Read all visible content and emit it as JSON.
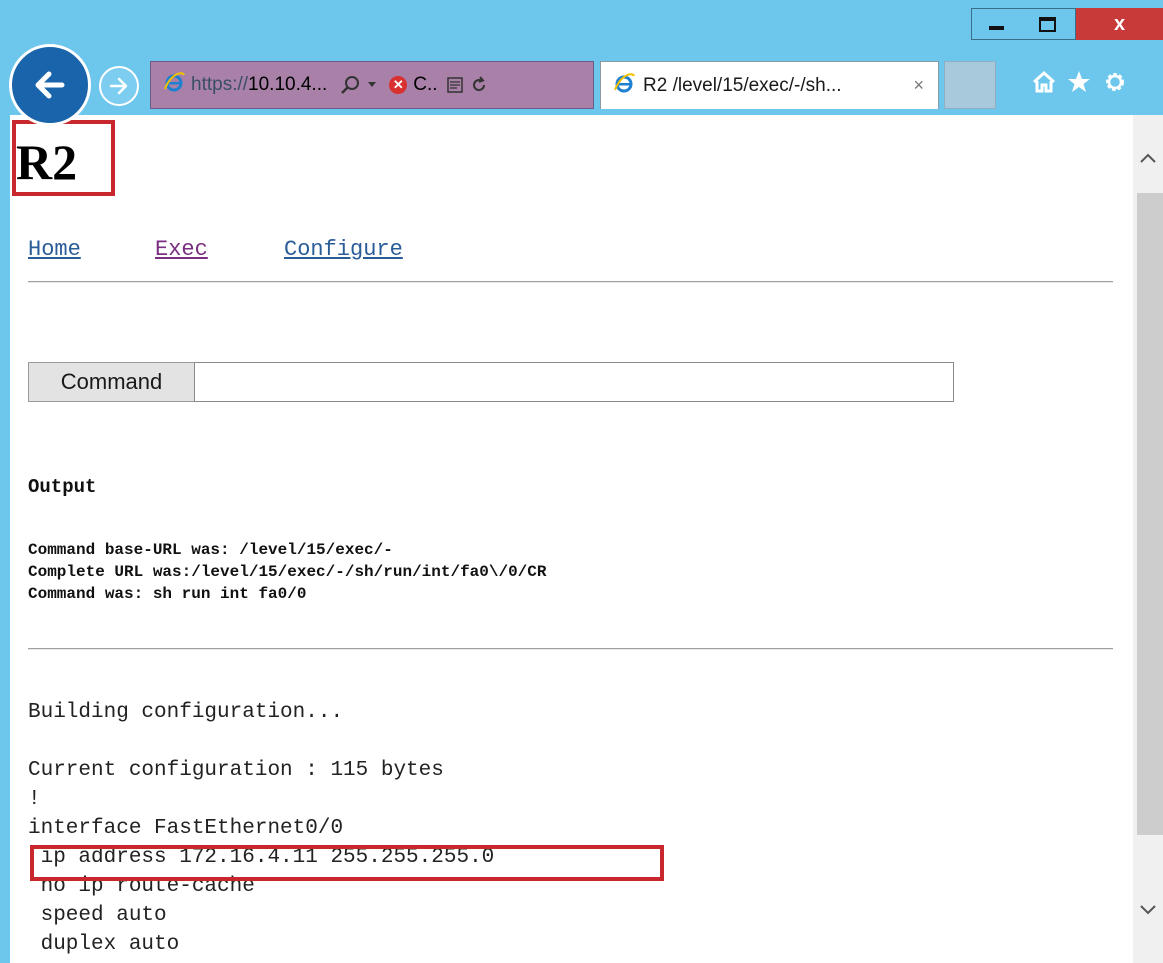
{
  "browser": {
    "address_protocol": "https://",
    "address_host": "10.10.4...",
    "cert_label": "C..",
    "tab_title": "R2 /level/15/exec/-/sh...",
    "tab_close": "×",
    "close_label": "x"
  },
  "page": {
    "title": "R2",
    "nav": {
      "home": "Home",
      "exec": "Exec",
      "configure": "Configure"
    },
    "command_button": "Command",
    "command_value": "",
    "output_heading": "Output",
    "command_info": [
      "Command base-URL was: /level/15/exec/-",
      "Complete URL was:/level/15/exec/-/sh/run/int/fa0\\/0/CR",
      "Command was: sh run int fa0/0"
    ],
    "config": {
      "building": "Building configuration...",
      "current": "Current configuration : 115 bytes",
      "bang": "!",
      "interface": "interface FastEthernet0/0",
      "ip_address": " ip address 172.16.4.11 255.255.255.0",
      "no_route_cache": " no ip route-cache",
      "speed": " speed auto",
      "duplex": " duplex auto"
    }
  },
  "colors": {
    "highlight": "#c8272e",
    "chrome": "#6dc6ec",
    "link": "#2a5c98",
    "visited_link": "#7a2e80"
  },
  "icons": [
    "back-arrow-icon",
    "forward-arrow-icon",
    "ie-logo-icon",
    "search-icon",
    "dropdown-icon",
    "certificate-error-icon",
    "compatibility-icon",
    "refresh-icon",
    "home-icon",
    "star-icon",
    "gear-icon",
    "minimize-icon",
    "maximize-icon",
    "scroll-up-icon",
    "scroll-down-icon"
  ]
}
